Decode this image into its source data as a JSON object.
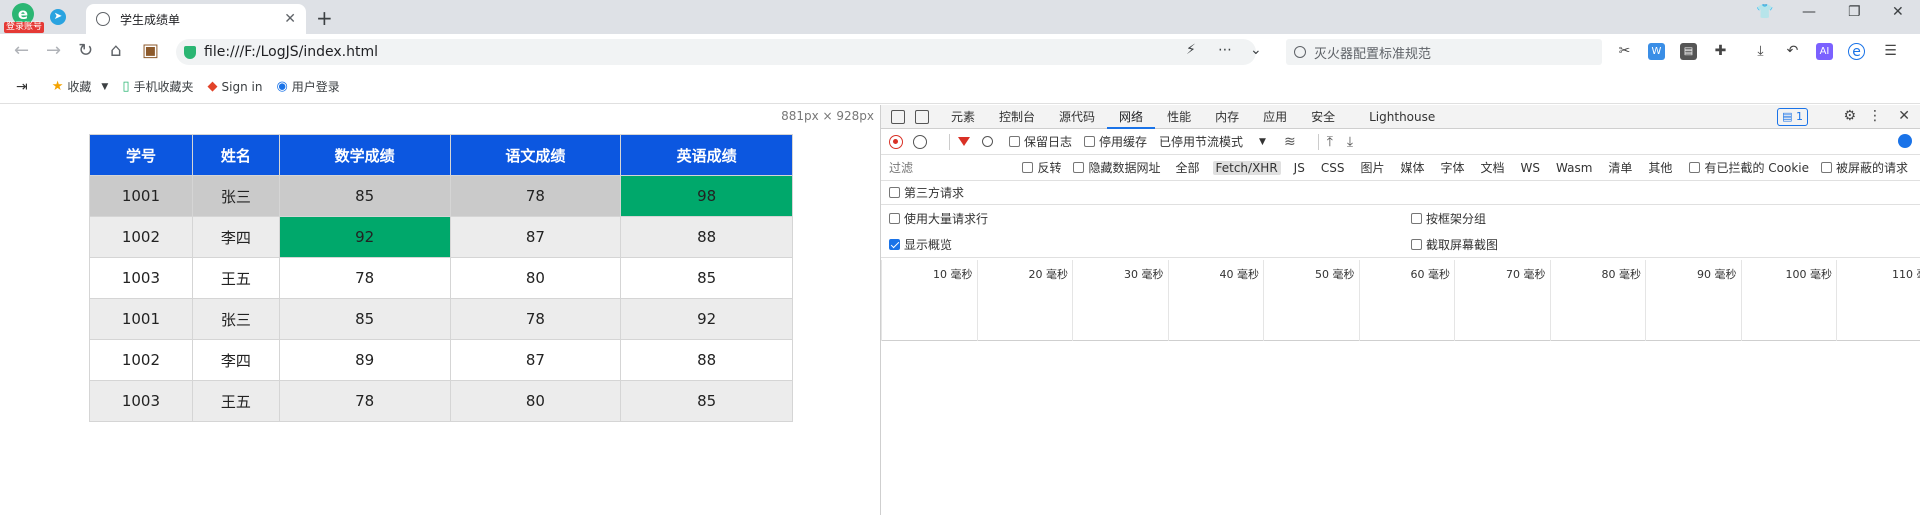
{
  "browser": {
    "logo_badge": "登录账号",
    "tab_title": "学生成绩单",
    "url": "file:///F:/LogJS/index.html",
    "search_placeholder": "灭火器配置标准规范",
    "ai_label": "AI"
  },
  "bookmarks": [
    {
      "label": "收藏",
      "icon": "star-icon"
    },
    {
      "label": "手机收藏夹",
      "icon": "phone-icon"
    },
    {
      "label": "Sign in",
      "icon": "gitlab-icon"
    },
    {
      "label": "用户登录",
      "icon": "user-login-icon"
    }
  ],
  "page": {
    "dimensions": "881px × 928px",
    "table": {
      "headers": [
        "学号",
        "姓名",
        "数学成绩",
        "语文成绩",
        "英语成绩"
      ],
      "rows": [
        [
          "1001",
          "张三",
          "85",
          "78",
          "98"
        ],
        [
          "1002",
          "李四",
          "92",
          "87",
          "88"
        ],
        [
          "1003",
          "王五",
          "78",
          "80",
          "85"
        ],
        [
          "1001",
          "张三",
          "85",
          "78",
          "92"
        ],
        [
          "1002",
          "李四",
          "89",
          "87",
          "88"
        ],
        [
          "1003",
          "王五",
          "78",
          "80",
          "85"
        ]
      ],
      "header_color": "#0c57e0",
      "highlight_color": "#00a86b"
    }
  },
  "devtools": {
    "tabs": [
      "元素",
      "控制台",
      "源代码",
      "网络",
      "性能",
      "内存",
      "应用",
      "安全",
      "Lighthouse"
    ],
    "active_tab": "网络",
    "issues_count": "1",
    "toolbar": {
      "preserve_log": "保留日志",
      "disable_cache": "停用缓存",
      "throttle": "已停用节流模式"
    },
    "filter": {
      "placeholder": "过滤",
      "invert": "反转",
      "hide_data_urls": "隐藏数据网址",
      "types": [
        "全部",
        "Fetch/XHR",
        "JS",
        "CSS",
        "图片",
        "媒体",
        "字体",
        "文档",
        "WS",
        "Wasm",
        "清单",
        "其他"
      ],
      "blocked_cookies": "有已拦截的 Cookie",
      "blocked_requests": "被屏蔽的请求",
      "third_party": "第三方请求"
    },
    "options": {
      "large_rows": "使用大量请求行",
      "group_by_frame": "按框架分组",
      "show_overview": "显示概览",
      "capture_screenshots": "截取屏幕截图"
    },
    "timeline_labels": [
      "10 毫秒",
      "20 毫秒",
      "30 毫秒",
      "40 毫秒",
      "50 毫秒",
      "60 毫秒",
      "70 毫秒",
      "80 毫秒",
      "90 毫秒",
      "100 毫秒",
      "110 毫"
    ]
  }
}
